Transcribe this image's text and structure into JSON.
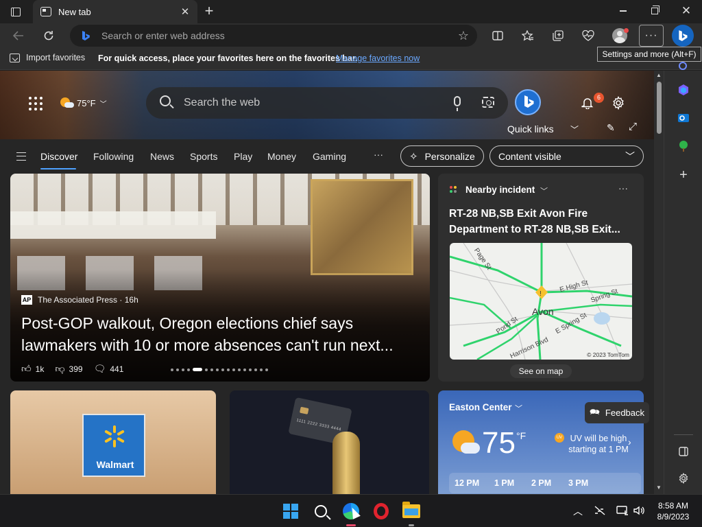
{
  "window": {
    "tab_title": "New tab",
    "tab_close": "✕",
    "new_tab": "+",
    "close": "✕"
  },
  "toolbar": {
    "address_placeholder": "Search or enter web address",
    "more_label": "···",
    "tooltip": "Settings and more (Alt+F)"
  },
  "favorites_bar": {
    "import_label": "Import favorites",
    "message": "For quick access, place your favorites here on the favorites bar.",
    "manage_link": "Manage favorites now"
  },
  "newtab": {
    "weather_temp": "75°F",
    "search_placeholder": "Search the web",
    "notification_count": "6",
    "quick_links_label": "Quick links",
    "nav_tabs": [
      "Discover",
      "Following",
      "News",
      "Sports",
      "Play",
      "Money",
      "Gaming"
    ],
    "nav_more": "···",
    "personalize_label": "Personalize",
    "content_visibility": "Content visible"
  },
  "hero": {
    "source_logo": "AP",
    "source": "The Associated Press · 16h",
    "title": "Post-GOP walkout, Oregon elections chief says lawmakers with 10 or more absences can't run next...",
    "likes": "1k",
    "dislikes": "399",
    "comments": "441"
  },
  "incident": {
    "label": "Nearby incident",
    "title": "RT-28 NB,SB Exit Avon Fire Department to RT-28 NB,SB Exit...",
    "map_town": "Avon",
    "map_streets": [
      "Page St",
      "E High St",
      "E Spring St",
      "Spring St",
      "Pond St",
      "Harrison Blvd"
    ],
    "map_copyright": "© 2023 TomTom",
    "see_map": "See on map"
  },
  "walmart": {
    "brand": "Walmart",
    "card_number": "1111 2222 3333 4444"
  },
  "weather": {
    "location": "Easton Center",
    "temp": "75",
    "unit": "°F",
    "uv_badge": "UV",
    "uv_text": "UV will be high starting at 1 PM",
    "hours": [
      "12 PM",
      "1 PM",
      "2 PM",
      "3 PM"
    ]
  },
  "feedback_label": "Feedback",
  "taskbar": {
    "time": "8:58 AM",
    "date": "8/9/2023"
  },
  "colors": {
    "accent_blue": "#4ea1ff",
    "link_blue": "#6aa8ff",
    "badge_orange": "#e8552f"
  }
}
